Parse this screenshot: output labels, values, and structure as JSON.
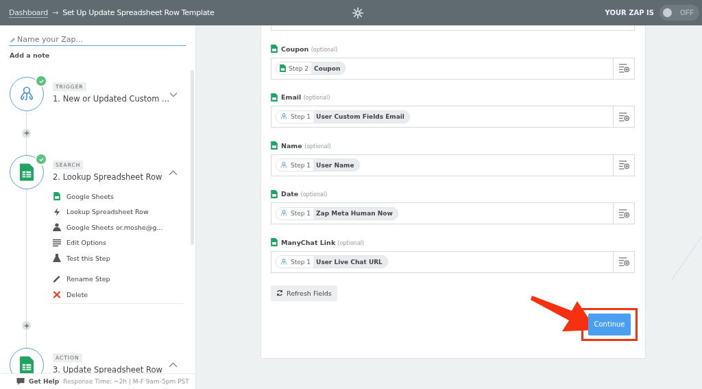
{
  "header": {
    "breadcrumb": "Dashboard",
    "arrow": "→",
    "title": "Set Up Update Spreadsheet Row Template",
    "zap_label": "YOUR ZAP IS",
    "toggle": {
      "on": false,
      "label": "OFF"
    }
  },
  "sidebar": {
    "name_field": {
      "placeholder": "Name your Zap..."
    },
    "add_note": "Add a note",
    "steps": [
      {
        "kind": "trigger",
        "badge": "TRIGGER",
        "title": "1. New or Updated Custom ...",
        "expanded": false,
        "done": true
      },
      {
        "kind": "sheets",
        "badge": "SEARCH",
        "title": "2. Lookup Spreadsheet Row",
        "expanded": true,
        "done": true,
        "items": [
          {
            "kind": "sheets",
            "label": "Google Sheets"
          },
          {
            "kind": "bolt",
            "label": "Lookup Spreadsheet Row"
          },
          {
            "kind": "person",
            "label": "Google Sheets or.moshe@g..."
          },
          {
            "kind": "lines",
            "label": "Edit Options"
          },
          {
            "kind": "flask",
            "label": "Test this Step"
          }
        ],
        "actions": [
          {
            "kind": "rename",
            "label": "Rename Step"
          },
          {
            "kind": "delete",
            "label": "Delete"
          }
        ]
      },
      {
        "kind": "sheets",
        "badge": "ACTION",
        "title": "3. Update Spreadsheet Row",
        "expanded": true,
        "done": false
      }
    ],
    "footer": {
      "help": "Get Help",
      "info": "Response Time: ~2h | M-F 9am-5pm PST"
    }
  },
  "form": {
    "fields": [
      {
        "label": "Coupon",
        "hint": "(optional)",
        "chip": {
          "kind": "sheets",
          "step": "Step 2",
          "value": "Coupon"
        }
      },
      {
        "label": "Email",
        "hint": "(optional)",
        "chip": {
          "kind": "manychat",
          "step": "Step 1",
          "value": "User Custom Fields Email"
        }
      },
      {
        "label": "Name",
        "hint": "(optional)",
        "chip": {
          "kind": "manychat",
          "step": "Step 1",
          "value": "User Name"
        }
      },
      {
        "label": "Date",
        "hint": "(optional)",
        "chip": {
          "kind": "manychat",
          "step": "Step 1",
          "value": "Zap Meta Human Now"
        }
      },
      {
        "label": "ManyChat Link",
        "hint": "(optional)",
        "chip": {
          "kind": "manychat",
          "step": "Step 1",
          "value": "User Live Chat URL"
        }
      }
    ],
    "refresh": "Refresh Fields",
    "continue": "Continue"
  }
}
